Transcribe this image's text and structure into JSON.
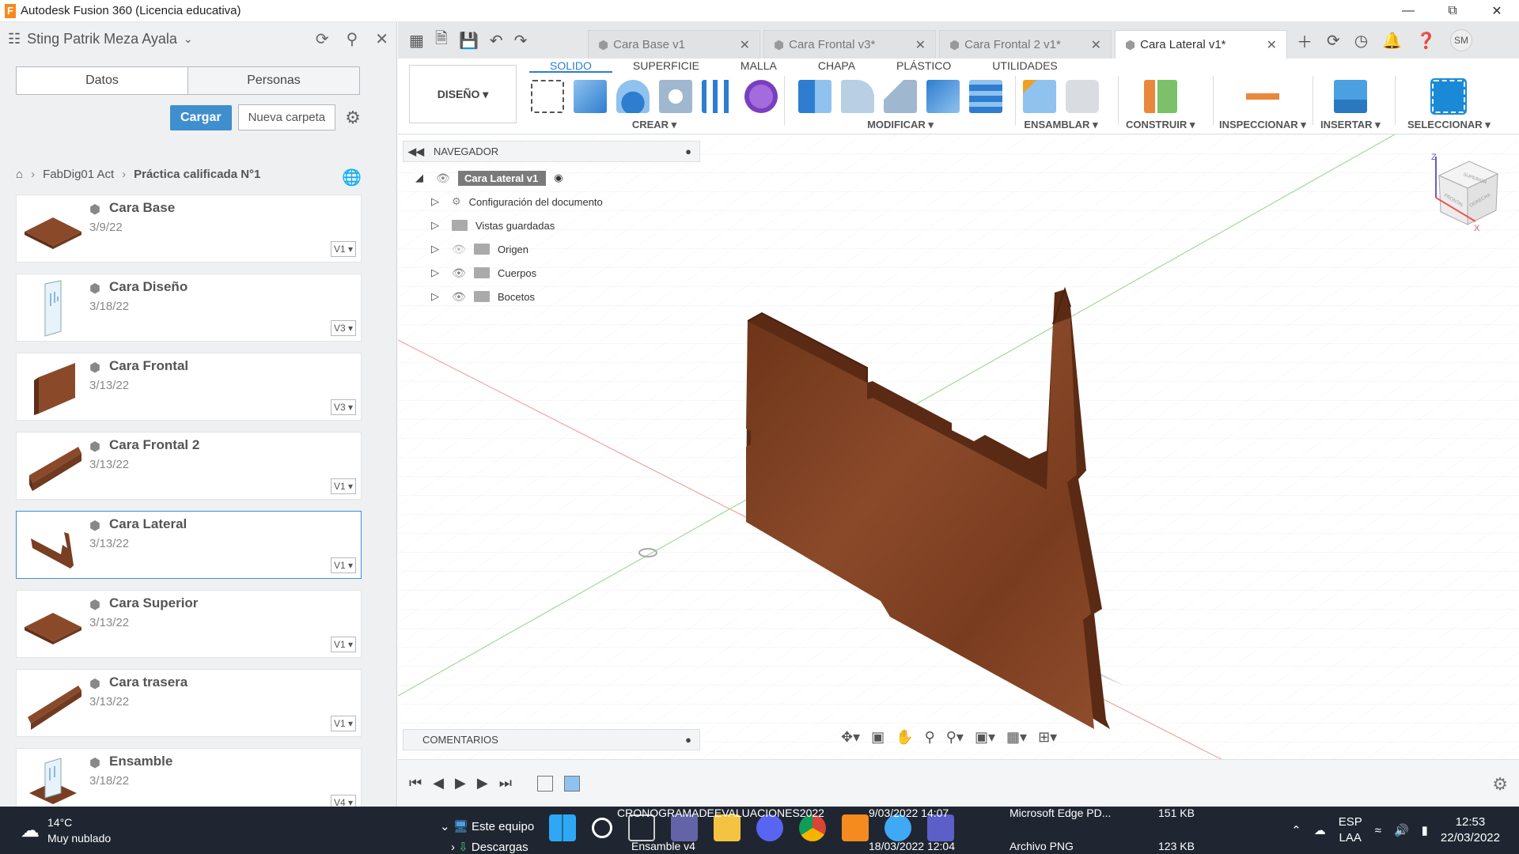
{
  "window": {
    "title": "Autodesk Fusion 360 (Licencia educativa)",
    "logo_letter": "F"
  },
  "data_panel": {
    "user": "Sting Patrik Meza Ayala",
    "tabs": [
      "Datos",
      "Personas"
    ],
    "upload_label": "Cargar",
    "new_folder_label": "Nueva carpeta",
    "breadcrumb": [
      "FabDig01 Act",
      "Práctica calificada N°1"
    ],
    "files": [
      {
        "name": "Cara Base",
        "date": "3/9/22",
        "version": "V1"
      },
      {
        "name": "Cara Diseño",
        "date": "3/18/22",
        "version": "V3"
      },
      {
        "name": "Cara Frontal",
        "date": "3/13/22",
        "version": "V3"
      },
      {
        "name": "Cara Frontal 2",
        "date": "3/13/22",
        "version": "V1"
      },
      {
        "name": "Cara Lateral",
        "date": "3/13/22",
        "version": "V1"
      },
      {
        "name": "Cara Superior",
        "date": "3/13/22",
        "version": "V1"
      },
      {
        "name": "Cara trasera",
        "date": "3/13/22",
        "version": "V1"
      },
      {
        "name": "Ensamble",
        "date": "3/18/22",
        "version": "V4"
      }
    ]
  },
  "doc_tabs": [
    {
      "label": "Cara Base v1"
    },
    {
      "label": "Cara Frontal v3*"
    },
    {
      "label": "Cara Frontal 2 v1*"
    },
    {
      "label": "Cara Lateral v1*"
    }
  ],
  "avatar_initials": "SM",
  "toolbar": {
    "workspace": "DISEÑO",
    "ws_tabs": [
      "SOLIDO",
      "SUPERFICIE",
      "MALLA",
      "CHAPA",
      "PLÁSTICO",
      "UTILIDADES"
    ],
    "groups": [
      "CREAR",
      "MODIFICAR",
      "ENSAMBLAR",
      "CONSTRUIR",
      "INSPECCIONAR",
      "INSERTAR",
      "SELECCIONAR"
    ]
  },
  "navigator": {
    "title": "NAVEGADOR",
    "root": "Cara Lateral v1",
    "items": [
      "Configuración del documento",
      "Vistas guardadas",
      "Origen",
      "Cuerpos",
      "Bocetos"
    ]
  },
  "comments_label": "COMENTARIOS",
  "viewcube": {
    "z": "Z",
    "x": "X",
    "faces": [
      "SUPERIOR",
      "FRONTAL",
      "DERECHA"
    ]
  },
  "colors": {
    "accent": "#2e7dd0",
    "wood": "#8a4a2a",
    "taskbar": "#1f2631"
  },
  "taskbar": {
    "temp": "14°C",
    "weather": "Muy nublado",
    "folder": "Este equipo",
    "subfolder": "Descargas",
    "files": [
      {
        "name": "CRONOGRAMADEEVALUACIONES2022",
        "date": "9/03/2022 14:07",
        "type": "Microsoft Edge PD...",
        "size": "151 KB"
      },
      {
        "name": "Ensamble v4",
        "date": "18/03/2022 12:04",
        "type": "Archivo PNG",
        "size": "123 KB"
      }
    ],
    "lang": "ESP",
    "lang2": "LAA",
    "time": "12:53",
    "date": "22/03/2022"
  }
}
